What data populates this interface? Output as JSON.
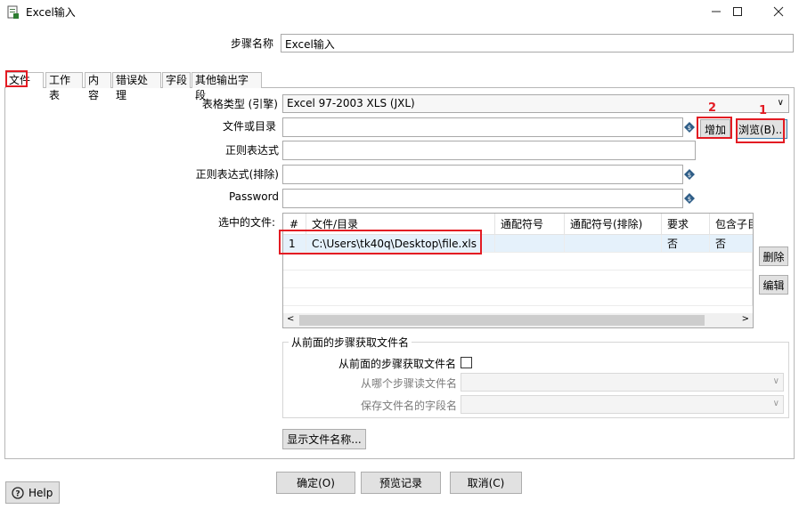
{
  "window": {
    "title": "Excel输入",
    "minimize_icon": "minimize-icon",
    "maximize_icon": "maximize-icon",
    "close_icon": "close-icon"
  },
  "step": {
    "label": "步骤名称",
    "value": "Excel输入"
  },
  "tabs": [
    {
      "label": "文件",
      "active": true
    },
    {
      "label": "工作表"
    },
    {
      "label": "内容"
    },
    {
      "label": "错误处理"
    },
    {
      "label": "字段"
    },
    {
      "label": "其他输出字段"
    }
  ],
  "form": {
    "spreadsheet_type_label": "表格类型 (引擎)",
    "spreadsheet_type_value": "Excel 97-2003 XLS (JXL)",
    "file_or_dir_label": "文件或目录",
    "file_or_dir_value": "",
    "regex_label": "正则表达式",
    "regex_exclude_label": "正则表达式(排除)",
    "password_label": "Password",
    "selected_files_label": "选中的文件:",
    "add_button": "增加",
    "browse_button": "浏览(B)...",
    "delete_button": "删除",
    "edit_button": "编辑"
  },
  "annotations": {
    "browse_num": "1",
    "add_num": "2",
    "color": "#e31b23"
  },
  "table": {
    "columns": [
      "#",
      "文件/目录",
      "通配符号",
      "通配符号(排除)",
      "要求",
      "包含子目"
    ],
    "rows": [
      {
        "num": "1",
        "file": "C:\\Users\\tk40q\\Desktop\\file.xls",
        "wildcard": "",
        "wildcard_exclude": "",
        "required": "否",
        "include_sub": "否"
      }
    ]
  },
  "prev_step": {
    "group_title": "从前面的步骤获取文件名",
    "checkbox_label": "从前面的步骤获取文件名",
    "step_label": "从哪个步骤读文件名",
    "field_label": "保存文件名的字段名"
  },
  "show_filenames_button": "显示文件名称...",
  "footer": {
    "ok": "确定(O)",
    "preview": "预览记录",
    "cancel": "取消(C)",
    "help": "Help"
  }
}
